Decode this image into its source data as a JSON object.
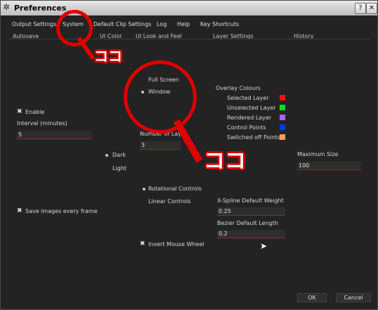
{
  "window": {
    "title": "Preferences",
    "help_btn": "?",
    "close_btn": "✕"
  },
  "tabs": [
    "Output Settings",
    "System",
    "Default Clip Settings",
    "Log",
    "Help",
    "Key Shortcuts"
  ],
  "subtabs": [
    "Autosave",
    "UI Color",
    "UI Look and Feel",
    "Layer Settings",
    "History"
  ],
  "autosave": {
    "enable_label": "Enable",
    "interval_label": "Interval (minutes)",
    "interval_value": "5",
    "save_images_label": "Save images every frame"
  },
  "ui_color": {
    "dark_label": "Dark",
    "light_label": "Light"
  },
  "look_feel": {
    "full_screen_label": "Full Screen",
    "window_label": "Window",
    "num_layers_label": "Number of Lay",
    "num_layers_value": "3",
    "rotational_label": "Rotational Controls",
    "linear_label": "Linear Controls",
    "invert_wheel_label": "Invert Mouse Wheel"
  },
  "layer_settings": {
    "overlay_title": "Overlay Colours",
    "overlays": [
      {
        "label": "Selected Layer",
        "color": "#ff1010"
      },
      {
        "label": "Unselected Layer",
        "color": "#10e010"
      },
      {
        "label": "Rendered Layer",
        "color": "#b060ff"
      },
      {
        "label": "Control Points",
        "color": "#1030ff"
      },
      {
        "label": "Switched off Points",
        "color": "#f0a060"
      }
    ],
    "xspline_label": "X-Spline Default Weight",
    "xspline_value": "0.25",
    "bezier_label": "Bezier Default Length",
    "bezier_value": "0.2"
  },
  "history": {
    "max_size_label": "Maximum Size",
    "max_size_value": "100"
  },
  "footer": {
    "ok": "OK",
    "cancel": "Cancel"
  },
  "annotations": {
    "koko": "ココ",
    "color": "#e00000"
  }
}
